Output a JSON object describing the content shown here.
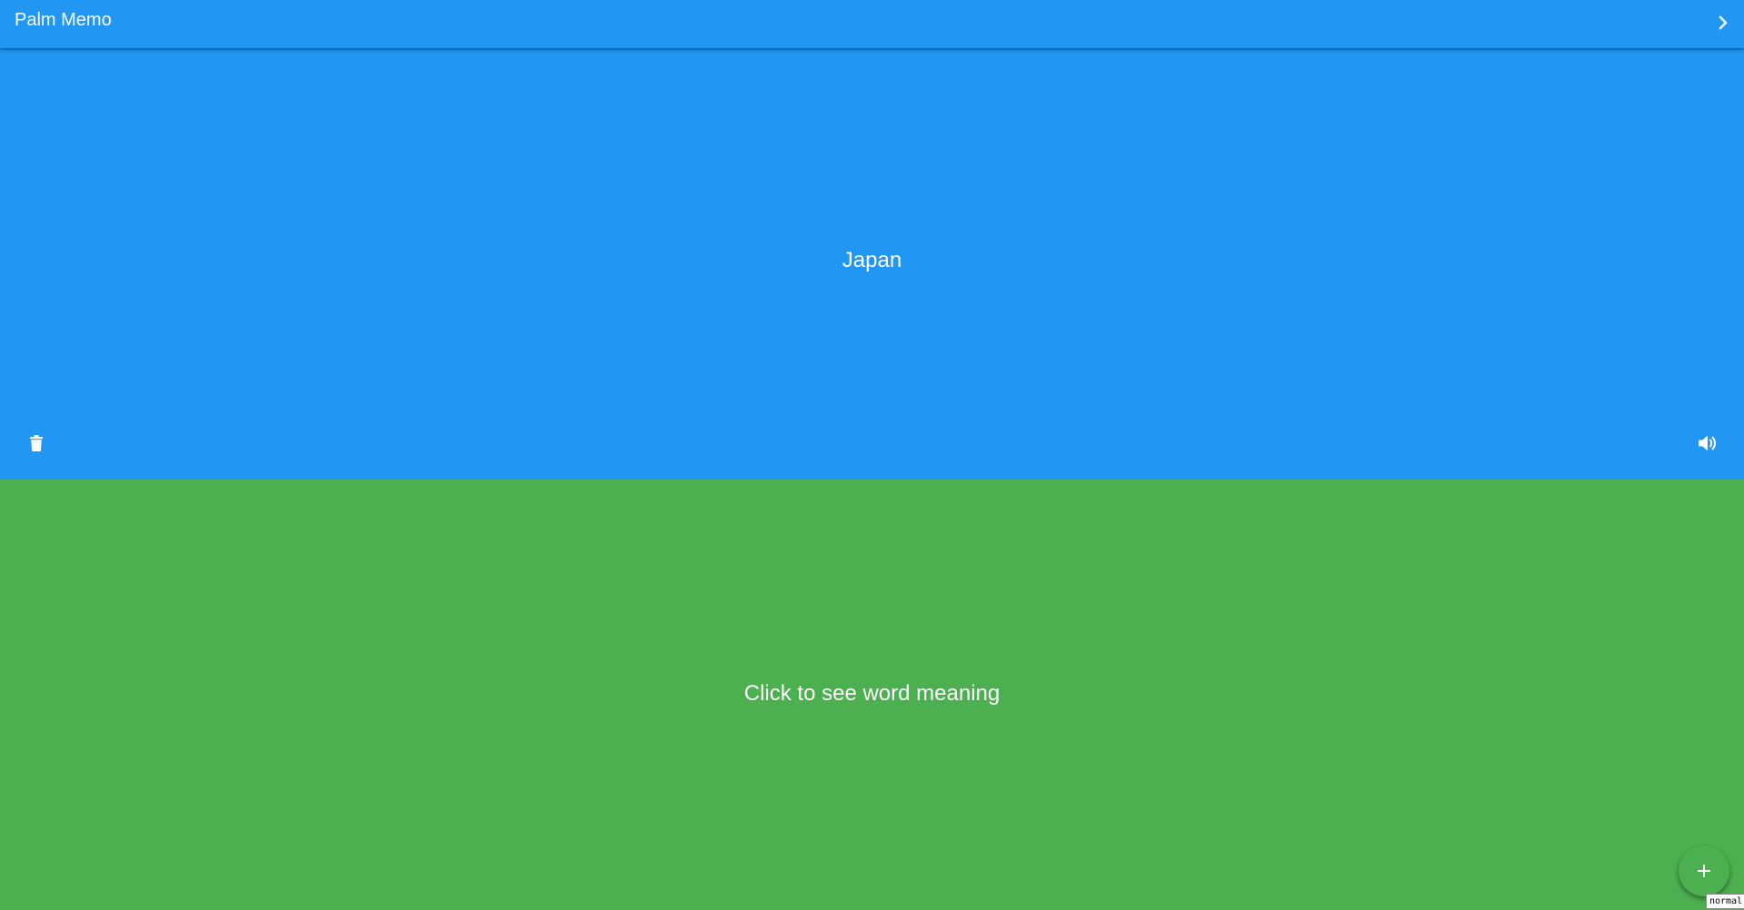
{
  "app_bar": {
    "title": "Palm Memo",
    "next_icon": "chevron-right-icon",
    "background_color": "#2196F3"
  },
  "word_card": {
    "word": "Japan",
    "delete_icon": "trash-icon",
    "speak_icon": "speaker-icon",
    "background_color": "#2196F3"
  },
  "meaning_card": {
    "prompt": "Click to see word meaning",
    "background_color": "#4CAF50"
  },
  "fab": {
    "icon": "plus-icon",
    "background_color": "#4CAF50"
  },
  "mode_indicator": {
    "label": "normal"
  }
}
